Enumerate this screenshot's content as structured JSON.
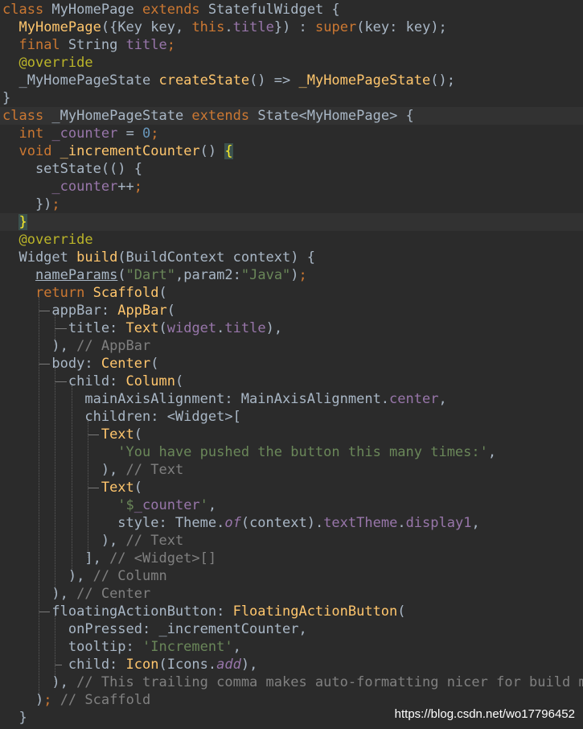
{
  "editor": {
    "language": "Dart",
    "lines": [
      [
        [
          "kw",
          "class "
        ],
        [
          "plain",
          "MyHomePage "
        ],
        [
          "kw",
          "extends "
        ],
        [
          "plain",
          "StatefulWidget {"
        ]
      ],
      [
        [
          "plain",
          "  "
        ],
        [
          "fn",
          "MyHomePage"
        ],
        [
          "plain",
          "({Key key, "
        ],
        [
          "kw",
          "this"
        ],
        [
          "plain",
          "."
        ],
        [
          "fld",
          "title"
        ],
        [
          "plain",
          "}) : "
        ],
        [
          "kw",
          "super"
        ],
        [
          "plain",
          "(key: key);"
        ]
      ],
      [
        [
          "plain",
          "  "
        ],
        [
          "kw",
          "final "
        ],
        [
          "plain",
          "String "
        ],
        [
          "fld",
          "title"
        ],
        [
          "kw",
          ";"
        ]
      ],
      [
        [
          "plain",
          "  "
        ],
        [
          "ann",
          "@override"
        ]
      ],
      [
        [
          "plain",
          "  _MyHomePageState "
        ],
        [
          "fn",
          "createState"
        ],
        [
          "plain",
          "() => "
        ],
        [
          "fn",
          "_MyHomePageState"
        ],
        [
          "plain",
          "();"
        ]
      ],
      [
        [
          "plain",
          "}"
        ]
      ],
      [
        [
          "kw",
          "class "
        ],
        [
          "plain",
          "_MyHomePageState "
        ],
        [
          "kw",
          "extends "
        ],
        [
          "plain",
          "State<MyHomePage> {"
        ]
      ],
      [
        [
          "plain",
          "  "
        ],
        [
          "kw",
          "int "
        ],
        [
          "fld",
          "_counter"
        ],
        [
          "plain",
          " = "
        ],
        [
          "num",
          "0"
        ],
        [
          "kw",
          ";"
        ]
      ],
      [
        [
          "plain",
          "  "
        ],
        [
          "kw",
          "void "
        ],
        [
          "fn",
          "_incrementCounter"
        ],
        [
          "plain",
          "() "
        ],
        [
          "brace-hl",
          "{"
        ]
      ],
      [
        [
          "plain",
          "    setState(() {"
        ]
      ],
      [
        [
          "plain",
          "      "
        ],
        [
          "fld",
          "_counter"
        ],
        [
          "plain",
          "++"
        ],
        [
          "kw",
          ";"
        ]
      ],
      [
        [
          "plain",
          "    })"
        ],
        [
          "kw",
          ";"
        ]
      ],
      [
        [
          "plain",
          "  "
        ],
        [
          "brace-hl",
          "}"
        ]
      ],
      [
        [
          "plain",
          "  "
        ],
        [
          "ann",
          "@override"
        ]
      ],
      [
        [
          "plain",
          "  Widget "
        ],
        [
          "fn",
          "build"
        ],
        [
          "plain",
          "(BuildContext context) {"
        ]
      ],
      [
        [
          "plain",
          "    "
        ],
        [
          "ul",
          "nameParams"
        ],
        [
          "plain",
          "("
        ],
        [
          "str",
          "\"Dart\""
        ],
        [
          "plain",
          ",param2:"
        ],
        [
          "str",
          "\"Java\""
        ],
        [
          "plain",
          ")"
        ],
        [
          "kw",
          ";"
        ]
      ],
      [
        [
          "plain",
          "    "
        ],
        [
          "kw",
          "return "
        ],
        [
          "fn",
          "Scaffold"
        ],
        [
          "plain",
          "("
        ]
      ],
      [
        [
          "plain",
          "      appBar: "
        ],
        [
          "fn",
          "AppBar"
        ],
        [
          "plain",
          "("
        ]
      ],
      [
        [
          "plain",
          "        title: "
        ],
        [
          "fn",
          "Text"
        ],
        [
          "plain",
          "("
        ],
        [
          "fld",
          "widget"
        ],
        [
          "plain",
          "."
        ],
        [
          "fld",
          "title"
        ],
        [
          "plain",
          "),"
        ]
      ],
      [
        [
          "plain",
          "      ), "
        ],
        [
          "cm",
          "// AppBar"
        ]
      ],
      [
        [
          "plain",
          "      body: "
        ],
        [
          "fn",
          "Center"
        ],
        [
          "plain",
          "("
        ]
      ],
      [
        [
          "plain",
          "        child: "
        ],
        [
          "fn",
          "Column"
        ],
        [
          "plain",
          "("
        ]
      ],
      [
        [
          "plain",
          "          mainAxisAlignment: MainAxisAlignment."
        ],
        [
          "fld",
          "center"
        ],
        [
          "plain",
          ","
        ]
      ],
      [
        [
          "plain",
          "          children: <Widget>["
        ]
      ],
      [
        [
          "plain",
          "            "
        ],
        [
          "fn",
          "Text"
        ],
        [
          "plain",
          "("
        ]
      ],
      [
        [
          "plain",
          "              "
        ],
        [
          "str",
          "'You have pushed the button this many times:'"
        ],
        [
          "plain",
          ","
        ]
      ],
      [
        [
          "plain",
          "            ), "
        ],
        [
          "cm",
          "// Text"
        ]
      ],
      [
        [
          "plain",
          "            "
        ],
        [
          "fn",
          "Text"
        ],
        [
          "plain",
          "("
        ]
      ],
      [
        [
          "plain",
          "              "
        ],
        [
          "str",
          "'$"
        ],
        [
          "fld",
          "_counter"
        ],
        [
          "str",
          "'"
        ],
        [
          "plain",
          ","
        ]
      ],
      [
        [
          "plain",
          "              style: Theme."
        ],
        [
          "ital",
          "of"
        ],
        [
          "plain",
          "(context)."
        ],
        [
          "fld",
          "textTheme"
        ],
        [
          "plain",
          "."
        ],
        [
          "fld",
          "display1"
        ],
        [
          "plain",
          ","
        ]
      ],
      [
        [
          "plain",
          "            ), "
        ],
        [
          "cm",
          "// Text"
        ]
      ],
      [
        [
          "plain",
          "          ], "
        ],
        [
          "cm",
          "// <Widget>[]"
        ]
      ],
      [
        [
          "plain",
          "        ), "
        ],
        [
          "cm",
          "// Column"
        ]
      ],
      [
        [
          "plain",
          "      ), "
        ],
        [
          "cm",
          "// Center"
        ]
      ],
      [
        [
          "plain",
          "      floatingActionButton: "
        ],
        [
          "fn",
          "FloatingActionButton"
        ],
        [
          "plain",
          "("
        ]
      ],
      [
        [
          "plain",
          "        onPressed: _incrementCounter,"
        ]
      ],
      [
        [
          "plain",
          "        tooltip: "
        ],
        [
          "str",
          "'Increment'"
        ],
        [
          "plain",
          ","
        ]
      ],
      [
        [
          "plain",
          "        child: "
        ],
        [
          "fn",
          "Icon"
        ],
        [
          "plain",
          "(Icons."
        ],
        [
          "ital",
          "add"
        ],
        [
          "plain",
          "),"
        ]
      ],
      [
        [
          "plain",
          "      ), "
        ],
        [
          "cm",
          "// This trailing comma makes auto-formatting nicer for build met"
        ]
      ],
      [
        [
          "plain",
          "    )"
        ],
        [
          "kw",
          ";"
        ],
        [
          "plain",
          " "
        ],
        [
          "cm",
          "// Scaffold"
        ]
      ],
      [
        [
          "plain",
          "  }"
        ]
      ]
    ],
    "highlighted_lines": [
      6,
      12
    ]
  },
  "watermark": {
    "text": "https://blog.csdn.net/wo17796452"
  }
}
